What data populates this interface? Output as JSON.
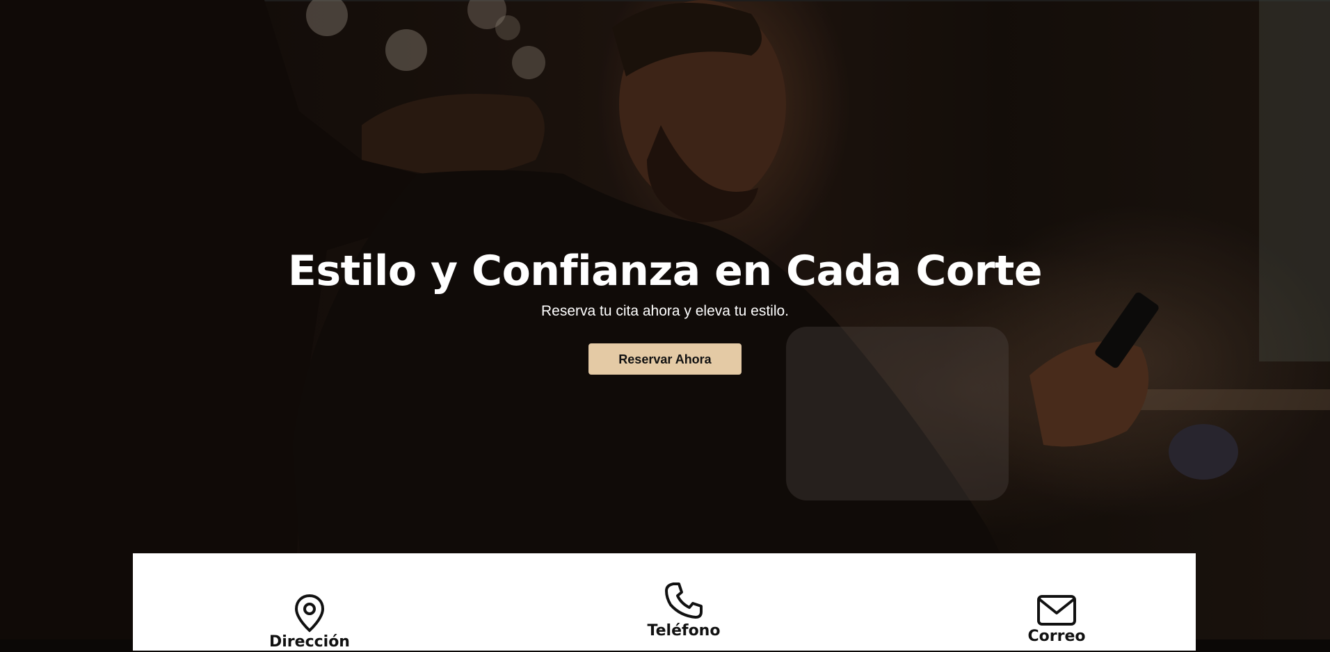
{
  "hero": {
    "title": "Estilo y Confianza en Cada Corte",
    "subtitle": "Reserva tu cita ahora y eleva tu estilo.",
    "cta_label": "Reservar Ahora",
    "image_subject": "barber-cutting-hair"
  },
  "info": {
    "items": [
      {
        "icon": "location-pin-icon",
        "label": "Dirección"
      },
      {
        "icon": "phone-icon",
        "label": "Teléfono"
      },
      {
        "icon": "mail-icon",
        "label": "Correo"
      }
    ]
  },
  "colors": {
    "accent": "#e4caa5",
    "card_bg": "#ffffff",
    "text_light": "#ffffff",
    "text_dark": "#111111"
  }
}
